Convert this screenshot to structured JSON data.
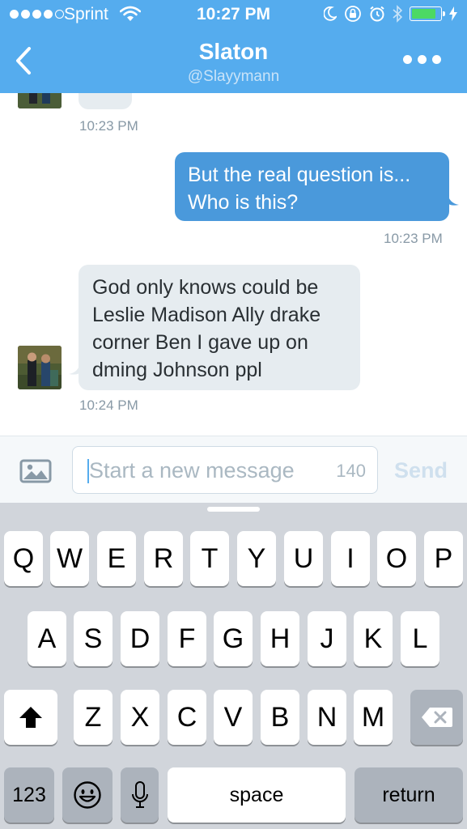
{
  "status_bar": {
    "carrier": "Sprint",
    "time": "10:27 PM"
  },
  "header": {
    "title": "Slaton",
    "handle": "@Slayymann"
  },
  "colors": {
    "accent": "#55acee",
    "outgoing_bubble": "#4a99db",
    "incoming_bubble": "#e6ecf0"
  },
  "messages": [
    {
      "direction": "incoming",
      "text": "",
      "time": "10:23 PM"
    },
    {
      "direction": "outgoing",
      "lines": [
        "But the real question is...",
        "Who is this?"
      ],
      "time": "10:23 PM"
    },
    {
      "direction": "incoming",
      "lines": [
        "God only knows could be",
        "Leslie Madison Ally drake",
        "corner Ben I gave up on",
        "dming Johnson ppl"
      ],
      "time": "10:24 PM"
    }
  ],
  "composer": {
    "placeholder": "Start a new message",
    "char_count": "140",
    "send_label": "Send"
  },
  "keyboard": {
    "row1": [
      "Q",
      "W",
      "E",
      "R",
      "T",
      "Y",
      "U",
      "I",
      "O",
      "P"
    ],
    "row2": [
      "A",
      "S",
      "D",
      "F",
      "G",
      "H",
      "J",
      "K",
      "L"
    ],
    "row3": [
      "Z",
      "X",
      "C",
      "V",
      "B",
      "N",
      "M"
    ],
    "numbers_label": "123",
    "space_label": "space",
    "return_label": "return",
    "icons": [
      "shift-icon",
      "delete-icon",
      "emoji-icon",
      "microphone-icon"
    ]
  }
}
